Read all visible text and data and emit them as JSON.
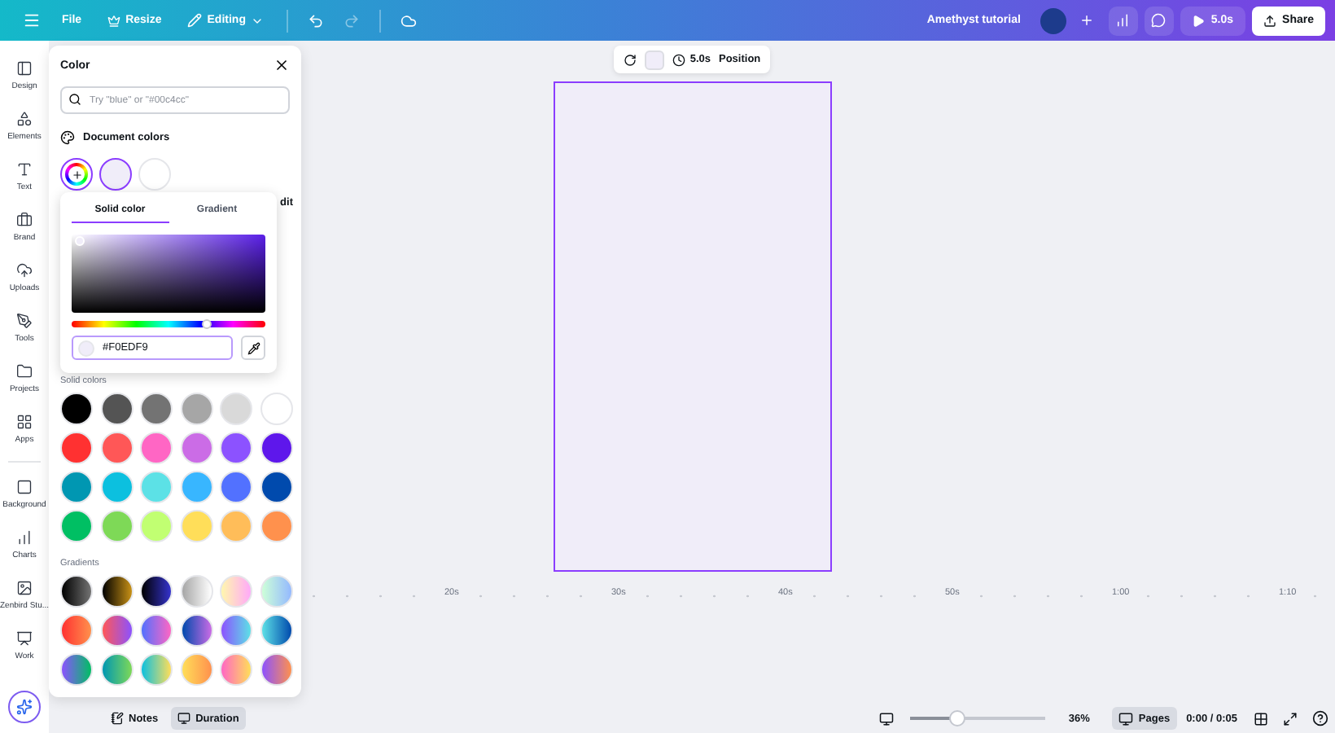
{
  "top_bar": {
    "menu": [
      {
        "label": "File",
        "kind": "plain"
      },
      {
        "label": "Resize",
        "kind": "crown"
      },
      {
        "label": "Editing",
        "kind": "dropdown"
      }
    ],
    "redo_disabled": true,
    "title": "Amethyst tutorial",
    "play_duration": "5.0s",
    "share_label": "Share"
  },
  "sidebar": {
    "items": [
      {
        "label": "Design"
      },
      {
        "label": "Elements"
      },
      {
        "label": "Text"
      },
      {
        "label": "Brand"
      },
      {
        "label": "Uploads"
      },
      {
        "label": "Tools"
      },
      {
        "label": "Projects"
      },
      {
        "label": "Apps"
      },
      {
        "label": "Background"
      },
      {
        "label": "Charts"
      },
      {
        "label": "Zenbird Stu..."
      },
      {
        "label": "Work"
      }
    ]
  },
  "canvas_toolbar": {
    "duration": "5.0s",
    "position_label": "Position"
  },
  "color_panel": {
    "title": "Color",
    "search_placeholder": "Try \"blue\" or \"#00c4cc\"",
    "document_colors_label": "Document colors",
    "document_colors": [
      {
        "color": "#f0edf9",
        "selected": true
      },
      {
        "color": "#ffffff",
        "selected": false
      }
    ],
    "covered_text": "dit",
    "picker": {
      "tabs": [
        {
          "label": "Solid color",
          "selected": true
        },
        {
          "label": "Gradient",
          "selected": false
        }
      ],
      "hue": {
        "level": 0.7
      },
      "hex": "#F0EDF9"
    },
    "solid_colors_label": "Solid colors",
    "solid_colors": [
      {
        "color": "#000000"
      },
      {
        "color": "#545454"
      },
      {
        "color": "#737373"
      },
      {
        "color": "#a6a6a6"
      },
      {
        "color": "#d9d9d9"
      },
      {
        "color": "#ffffff"
      },
      {
        "color": "#ff3131"
      },
      {
        "color": "#ff5757"
      },
      {
        "color": "#ff66c4"
      },
      {
        "color": "#cb6ce6"
      },
      {
        "color": "#8c52ff"
      },
      {
        "color": "#5e17eb"
      },
      {
        "color": "#0097b2"
      },
      {
        "color": "#0cc0df"
      },
      {
        "color": "#5ce1e6"
      },
      {
        "color": "#38b6ff"
      },
      {
        "color": "#5271ff"
      },
      {
        "color": "#004aad"
      },
      {
        "color": "#00bf63"
      },
      {
        "color": "#7ed957"
      },
      {
        "color": "#c1ff72"
      },
      {
        "color": "#ffde59"
      },
      {
        "color": "#ffbd59"
      },
      {
        "color": "#ff914d"
      }
    ],
    "gradients_label": "Gradients"
  },
  "timeline": {
    "ticks": [
      "20s",
      "30s",
      "40s",
      "50s",
      "1:00",
      "1:10"
    ]
  },
  "bottom_bar": {
    "notes_label": "Notes",
    "duration_label": "Duration",
    "duration_selected": true,
    "zoom_slider": {
      "level": 0.35
    },
    "zoom": "36%",
    "pages_label": "Pages",
    "pages_selected": true,
    "time": "0:00 / 0:05"
  }
}
